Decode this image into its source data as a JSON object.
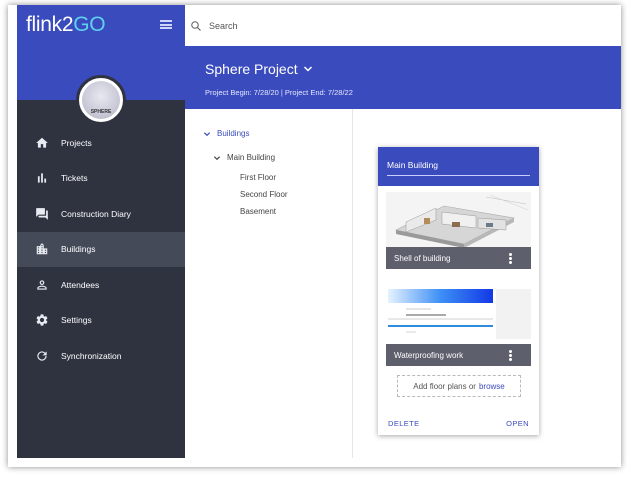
{
  "app": {
    "logo_text_main": "flink",
    "logo_text_2": "2",
    "logo_text_go": "GO",
    "avatar_text": "SPHERE"
  },
  "search": {
    "placeholder": "Search"
  },
  "sidebar": {
    "items": [
      {
        "label": "Projects",
        "icon": "home-icon",
        "active": false
      },
      {
        "label": "Tickets",
        "icon": "bar-chart-icon",
        "active": false
      },
      {
        "label": "Construction Diary",
        "icon": "forum-icon",
        "active": false
      },
      {
        "label": "Buildings",
        "icon": "city-icon",
        "active": true
      },
      {
        "label": "Attendees",
        "icon": "person-icon",
        "active": false
      },
      {
        "label": "Settings",
        "icon": "gear-icon",
        "active": false
      },
      {
        "label": "Synchronization",
        "icon": "sync-icon",
        "active": false
      }
    ]
  },
  "header": {
    "project_title": "Sphere Project",
    "project_dates": "Project Begin: 7/28/20   |   Project End: 7/28/22"
  },
  "tree": {
    "root": "Buildings",
    "building": "Main Building",
    "floors": [
      "First Floor",
      "Second Floor",
      "Basement"
    ]
  },
  "card": {
    "title": "Main Building",
    "tiles": [
      {
        "label": "Shell of building"
      },
      {
        "label": "Waterproofing work"
      }
    ],
    "dropzone_text": "Add floor plans or",
    "dropzone_link": "browse",
    "delete_label": "DELETE",
    "open_label": "OPEN"
  },
  "colors": {
    "brand_blue": "#3a4bbd",
    "sidebar_dark": "#2f3340",
    "sidebar_active": "#454a59",
    "tile_label_bg": "#5d5f6c"
  }
}
